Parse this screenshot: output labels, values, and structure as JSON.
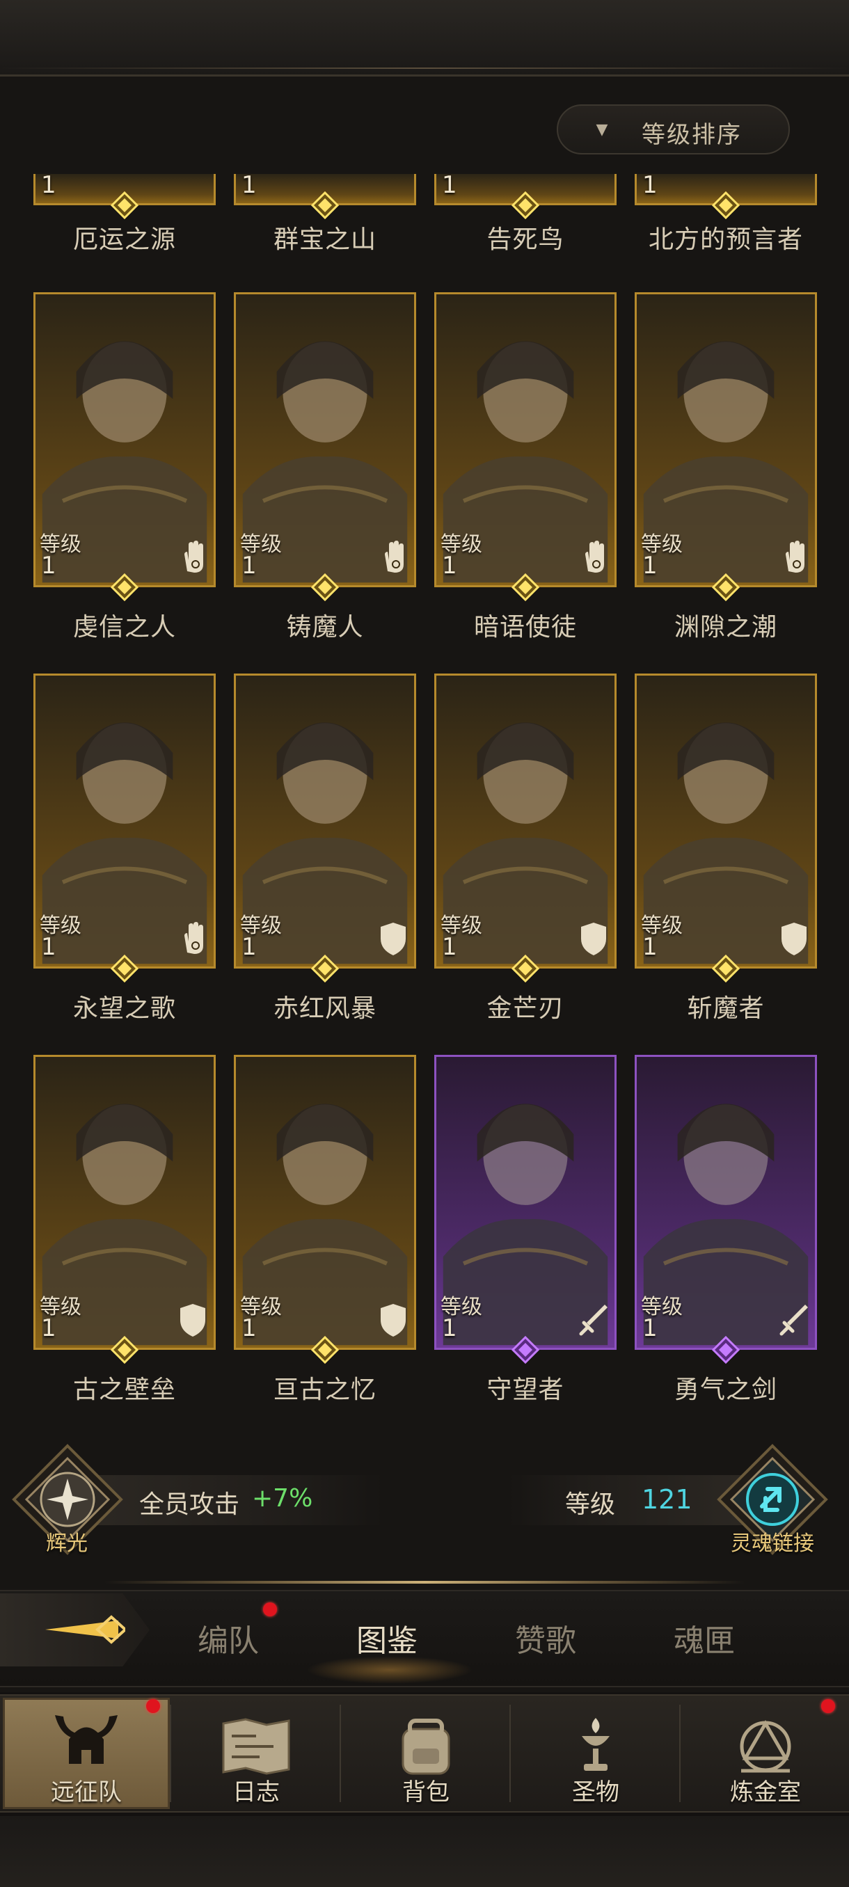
{
  "sort": {
    "label": "等级排序"
  },
  "top_row_names": [
    "厄运之源",
    "群宝之山",
    "告死鸟",
    "北方的预言者"
  ],
  "top_row_level": "1",
  "heroes": [
    {
      "name": "虔信之人",
      "level_label": "等级",
      "level": "1",
      "rarity": "gold",
      "class_icon": "hand-icon"
    },
    {
      "name": "铸魔人",
      "level_label": "等级",
      "level": "1",
      "rarity": "gold",
      "class_icon": "hand-icon"
    },
    {
      "name": "暗语使徒",
      "level_label": "等级",
      "level": "1",
      "rarity": "gold",
      "class_icon": "hand-icon"
    },
    {
      "name": "渊隙之潮",
      "level_label": "等级",
      "level": "1",
      "rarity": "gold",
      "class_icon": "hand-icon"
    },
    {
      "name": "永望之歌",
      "level_label": "等级",
      "level": "1",
      "rarity": "gold",
      "class_icon": "hand-icon"
    },
    {
      "name": "赤红风暴",
      "level_label": "等级",
      "level": "1",
      "rarity": "gold",
      "class_icon": "shield-icon"
    },
    {
      "name": "金芒刃",
      "level_label": "等级",
      "level": "1",
      "rarity": "gold",
      "class_icon": "shield-icon"
    },
    {
      "name": "斩魔者",
      "level_label": "等级",
      "level": "1",
      "rarity": "gold",
      "class_icon": "shield-icon"
    },
    {
      "name": "古之壁垒",
      "level_label": "等级",
      "level": "1",
      "rarity": "gold",
      "class_icon": "shield-icon"
    },
    {
      "name": "亘古之忆",
      "level_label": "等级",
      "level": "1",
      "rarity": "gold",
      "class_icon": "shield-icon"
    },
    {
      "name": "守望者",
      "level_label": "等级",
      "level": "1",
      "rarity": "purple",
      "class_icon": "sword-icon"
    },
    {
      "name": "勇气之剑",
      "level_label": "等级",
      "level": "1",
      "rarity": "purple",
      "class_icon": "sword-icon"
    }
  ],
  "status": {
    "radiance_label": "辉光",
    "attack_label": "全员攻击",
    "attack_value": "+7%",
    "level_label": "等级",
    "level_value": "121",
    "soul_link_label": "灵魂链接"
  },
  "tabs": [
    {
      "label": "编队",
      "active": false,
      "badge": true
    },
    {
      "label": "图鉴",
      "active": true,
      "badge": false
    },
    {
      "label": "赞歌",
      "active": false,
      "badge": false
    },
    {
      "label": "魂匣",
      "active": false,
      "badge": false
    }
  ],
  "nav": [
    {
      "label": "远征队",
      "icon": "horned-helmet-icon",
      "active": true,
      "badge": true
    },
    {
      "label": "日志",
      "icon": "map-scroll-icon",
      "active": false,
      "badge": false
    },
    {
      "label": "背包",
      "icon": "backpack-icon",
      "active": false,
      "badge": false
    },
    {
      "label": "圣物",
      "icon": "chalice-icon",
      "active": false,
      "badge": false
    },
    {
      "label": "炼金室",
      "icon": "alchemy-icon",
      "active": false,
      "badge": true
    }
  ],
  "colors": {
    "gold_border": "#b68a2c",
    "purple_border": "#8d52c0",
    "attack_green": "#6ddf6a",
    "level_cyan": "#4fd4e0",
    "badge_red": "#e0141e"
  }
}
